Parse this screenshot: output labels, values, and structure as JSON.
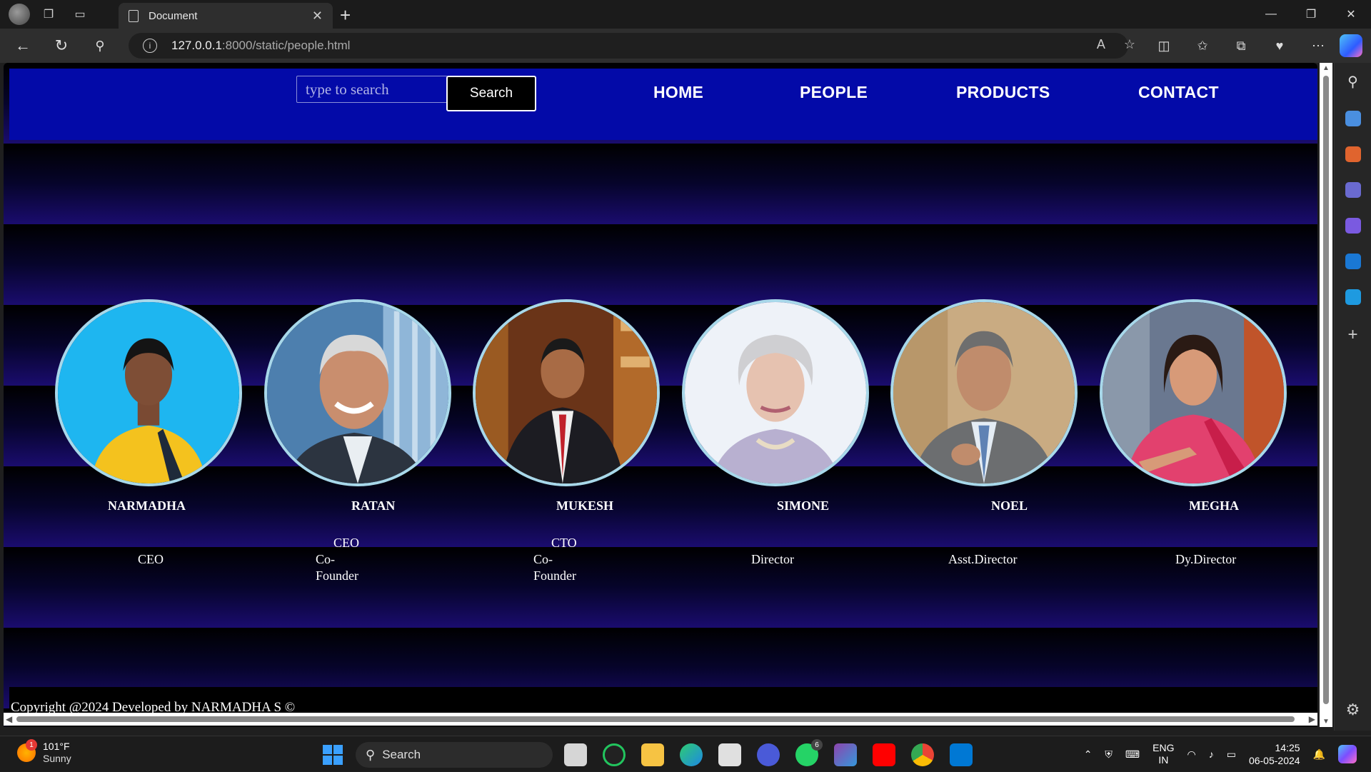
{
  "browser": {
    "tab_title": "Document",
    "url_host": "127.0.0.1",
    "url_path": ":8000/static/people.html"
  },
  "page": {
    "search_placeholder": "type to search",
    "search_button": "Search",
    "nav": [
      "HOME",
      "PEOPLE",
      "PRODUCTS",
      "CONTACT"
    ],
    "people": [
      {
        "name": "NARMADHA",
        "role_lines": [
          "CEO"
        ]
      },
      {
        "name": "RATAN",
        "role_lines": [
          "CEO",
          "Co-",
          "Founder"
        ]
      },
      {
        "name": "MUKESH",
        "role_lines": [
          "CTO",
          "Co-",
          "Founder"
        ]
      },
      {
        "name": "SIMONE",
        "role_lines": [
          "Director"
        ]
      },
      {
        "name": "NOEL",
        "role_lines": [
          "Asst.Director"
        ]
      },
      {
        "name": "MEGHA",
        "role_lines": [
          "Dy.Director"
        ]
      }
    ],
    "footer": "Copyright @2024 Developed by NARMADHA S ©"
  },
  "taskbar": {
    "weather_temp": "101°F",
    "weather_cond": "Sunny",
    "weather_badge": "1",
    "search_label": "Search",
    "whatsapp_badge": "6",
    "lang_top": "ENG",
    "lang_bottom": "IN",
    "time": "14:25",
    "date": "06-05-2024"
  },
  "colors": {
    "header_blue": "#030aa8",
    "photo_border": "#a8d8ea",
    "band_purple": "#1a0c6e"
  }
}
